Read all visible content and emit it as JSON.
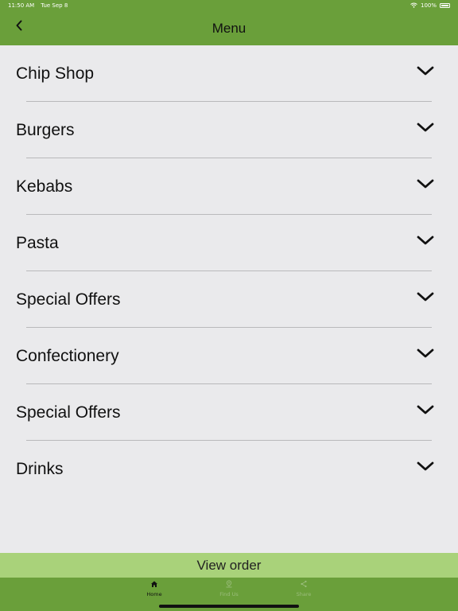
{
  "status_bar": {
    "time": "11:50 AM",
    "date": "Tue Sep 8",
    "battery": "100%"
  },
  "header": {
    "title": "Menu"
  },
  "menu": {
    "items": [
      {
        "label": "Chip Shop"
      },
      {
        "label": "Burgers"
      },
      {
        "label": "Kebabs"
      },
      {
        "label": "Pasta"
      },
      {
        "label": "Special Offers"
      },
      {
        "label": "Confectionery"
      },
      {
        "label": "Special Offers"
      },
      {
        "label": "Drinks"
      }
    ]
  },
  "view_order": {
    "label": "View order"
  },
  "tabs": [
    {
      "label": "Home",
      "icon": "home-icon",
      "active": true
    },
    {
      "label": "Find Us",
      "icon": "location-pin-icon",
      "active": false
    },
    {
      "label": "Share",
      "icon": "share-icon",
      "active": false
    }
  ],
  "colors": {
    "header_bg": "#6a9f3a",
    "view_order_bg": "#a9d27a",
    "page_bg": "#eaeaec"
  }
}
